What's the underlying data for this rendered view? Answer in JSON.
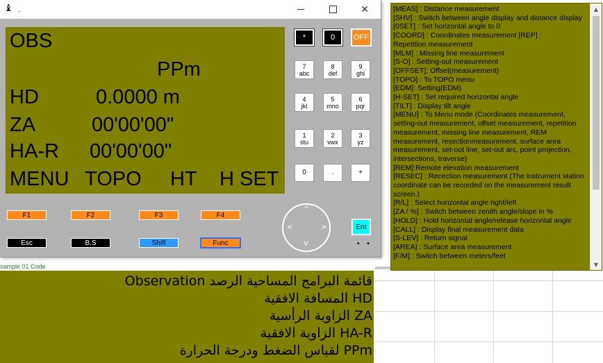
{
  "window": {
    "icon": "♝",
    "title": ".",
    "controls": {
      "minimize": "minimize-icon",
      "maximize": "maximize-icon",
      "close": "✕"
    }
  },
  "lcd": {
    "line1": "OBS",
    "line2": "PPm",
    "line3_label": "HD",
    "line3_value": "0.0000 m",
    "line4_label": "ZA",
    "line4_value": "00'00'00\"",
    "line5_label": "HA-R",
    "line5_value": "00'00'00\"",
    "softkeys": [
      "MENU",
      "TOPO",
      "HT",
      "H SET"
    ]
  },
  "keypad": {
    "top": [
      "*",
      "0",
      "OFF"
    ],
    "row1": [
      {
        "num": "7",
        "sub": "abc"
      },
      {
        "num": "8",
        "sub": "def"
      },
      {
        "num": "9",
        "sub": "ghi"
      }
    ],
    "row2": [
      {
        "num": "4",
        "sub": "jkl"
      },
      {
        "num": "5",
        "sub": "mno"
      },
      {
        "num": "6",
        "sub": "pqr"
      }
    ],
    "row3": [
      {
        "num": "1",
        "sub": "stu"
      },
      {
        "num": "2",
        "sub": "vwx"
      },
      {
        "num": "3",
        "sub": "yz"
      }
    ],
    "row4": [
      "0",
      ".",
      "+"
    ]
  },
  "function_keys": [
    "F1",
    "F2",
    "F3",
    "F4"
  ],
  "bottom_keys": [
    "Esc",
    "B.S",
    "Shift",
    "Func"
  ],
  "dpad": {
    "up": "^",
    "down": "V",
    "left": "<",
    "right": ">"
  },
  "enter_key": "Ent",
  "dots": "• •",
  "background_snippet": "sample 01 Code",
  "help": [
    "[MEAS]    : Distance measurement",
    "[SHV]      : Switch between angle display and distance display",
    "[0SET]    : Set horizontal angle to 0",
    "[COORD] : Coordinates measurement [REP]          :",
    "Repetition measurement",
    "[MLM]      : Missing line measurement",
    "[S-O]       : Setting-out measurement",
    "[OFFSET]: Offset(measurement)",
    "[TOPO]    : To TOPO menu",
    "[EDM]:  Setting(EDM)",
    "[H-SET]   : Set required horizontal angle",
    "[TILT]      : Display tilt angle",
    "[MENU]    : To Menu mode (Coordinates measurement, setting-out measurement, offset measurement, repetition measurement, missing line measurement, REM measurement, resectionmeasurement, surface area measurement, set-out line, set-out arc, point projection, intersections, traverse)",
    "[REM]:Remote elevation measurement",
    "[RESEC]  : Recection measurement (The instrument station coordinate can be recorded on the measurement result screen.)",
    "[R/L]        :   Select horizontal angle right/left",
    "[ZA / %]  : Switch between zenith angle/slope in %",
    "   [HOLD]   : Hold horizontal angle/release horizontal angle",
    "[CALL]      : Display final measurement data",
    "[S-LEV]    : Return signal",
    "[AREA]      :   Surface area measurement",
    "[F/M]         :   Switch between meters/feet"
  ],
  "scrollbar": {
    "up": "▲",
    "down": "▼"
  },
  "arabic": [
    "Observation  قائمة البرامج المساحية  الرصد",
    "المسافة الافقية  HD",
    "الزاوية الرأسية  ZA",
    "الزاوية الافقية  HA-R",
    "لقياس الضغط ودرجة الحرارة  PPm"
  ]
}
